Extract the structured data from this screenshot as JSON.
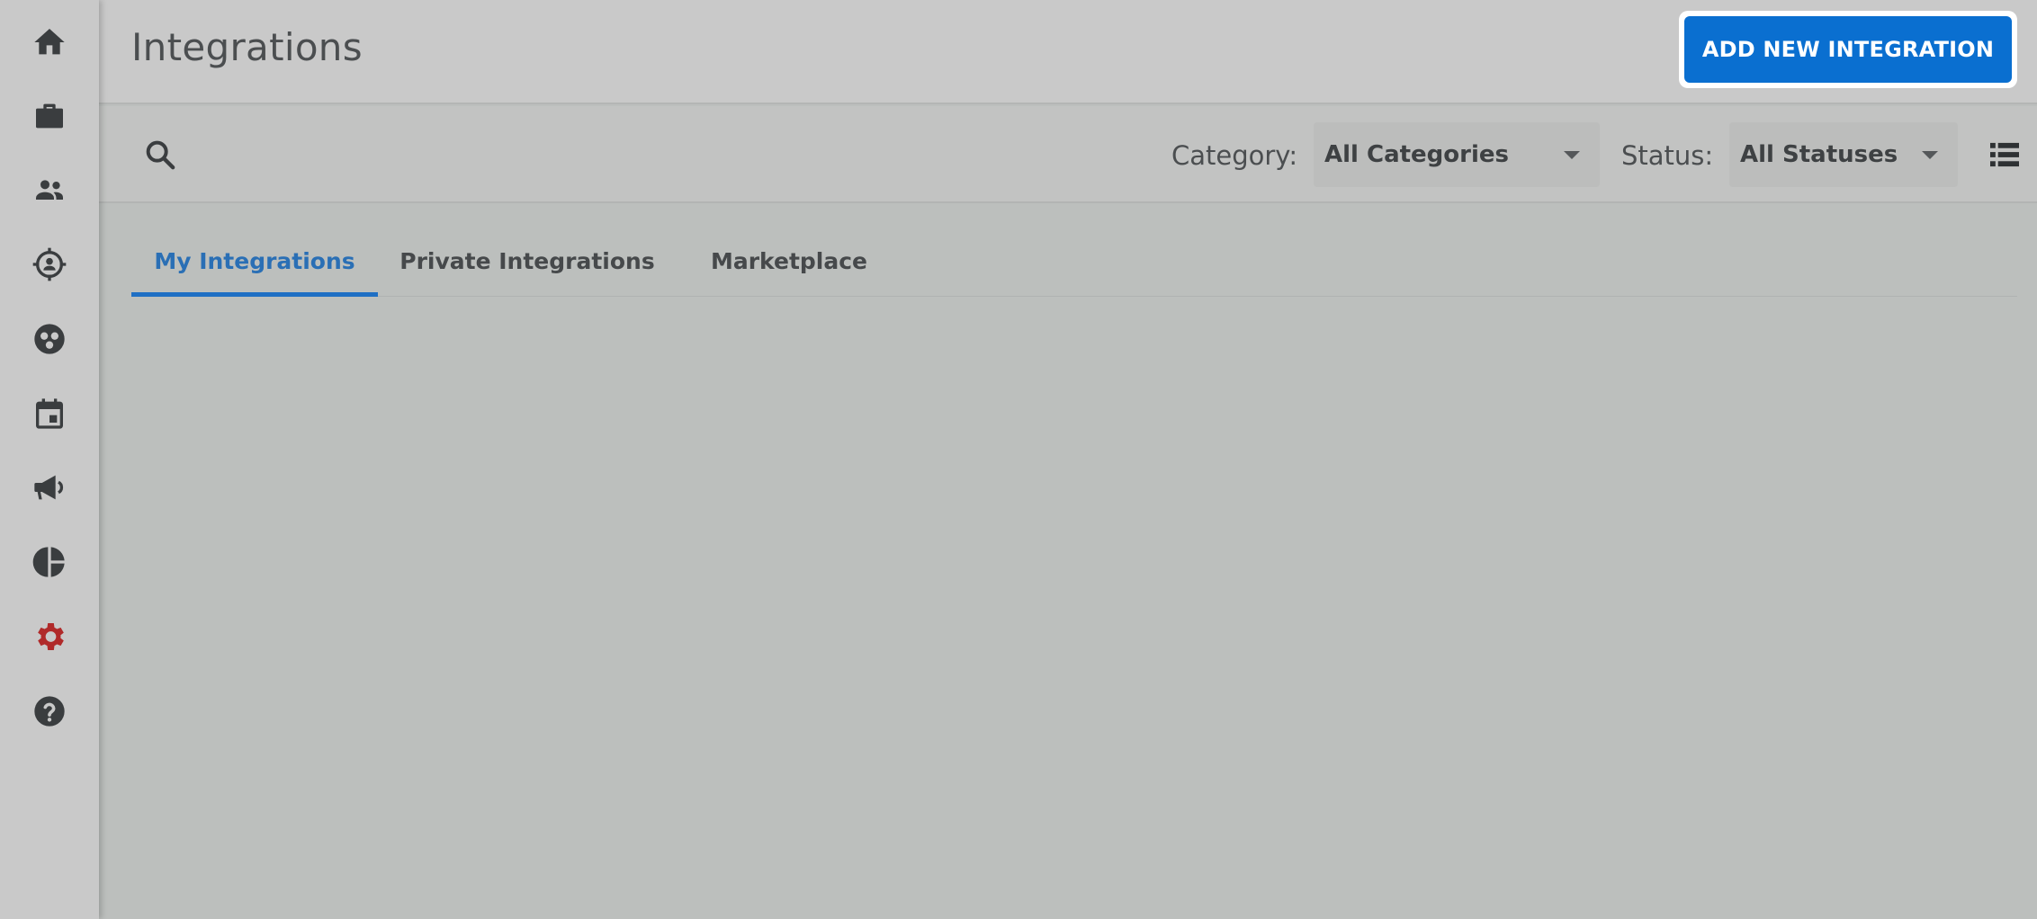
{
  "sidebar": {
    "items": [
      {
        "icon": "home-icon",
        "label": "Home"
      },
      {
        "icon": "briefcase-icon",
        "label": "Jobs"
      },
      {
        "icon": "people-icon",
        "label": "Candidates"
      },
      {
        "icon": "target-icon",
        "label": "Sourcing"
      },
      {
        "icon": "circles-icon",
        "label": "Talent Pools"
      },
      {
        "icon": "calendar-icon",
        "label": "Calendar"
      },
      {
        "icon": "megaphone-icon",
        "label": "Campaigns"
      },
      {
        "icon": "pie-chart-icon",
        "label": "Reports"
      },
      {
        "icon": "gear-icon",
        "label": "Settings",
        "active": true
      },
      {
        "icon": "help-icon",
        "label": "Help"
      }
    ]
  },
  "header": {
    "title": "Integrations",
    "add_button_label": "ADD NEW INTEGRATION"
  },
  "toolbar": {
    "category_label": "Category:",
    "category_value": "All Categories",
    "status_label": "Status:",
    "status_value": "All Statuses"
  },
  "tabs": [
    {
      "label": "My Integrations",
      "active": true
    },
    {
      "label": "Private Integrations",
      "active": false
    },
    {
      "label": "Marketplace",
      "active": false
    }
  ],
  "colors": {
    "accent": "#0a6fd0",
    "active_tab": "#2a6fb5",
    "settings_icon": "#b02a2a",
    "icon": "#3a3d3f"
  }
}
